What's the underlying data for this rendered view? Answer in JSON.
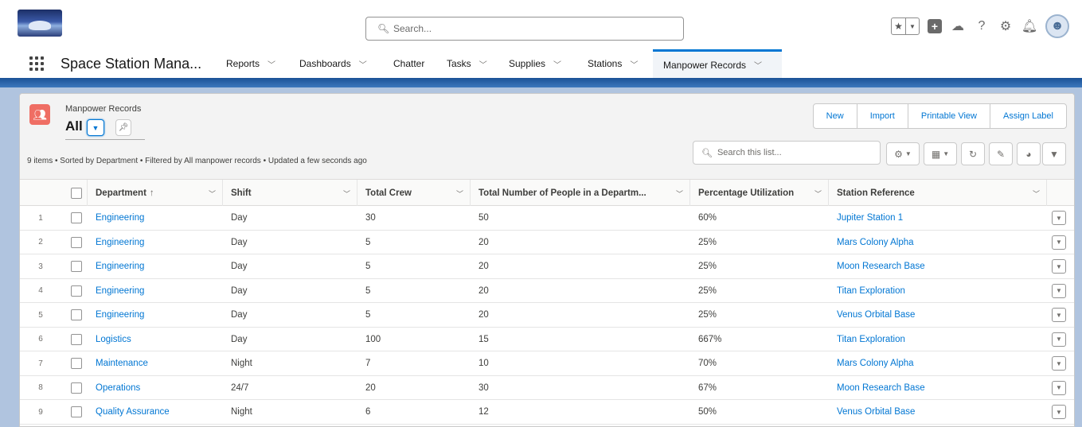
{
  "global_header": {
    "search_placeholder": "Search...",
    "icons": [
      "star-icon",
      "chevron-down-icon",
      "add-icon",
      "cloud-icon",
      "help-icon",
      "gear-icon",
      "bell-icon",
      "avatar"
    ]
  },
  "nav": {
    "app_name": "Space Station Mana...",
    "items": [
      {
        "label": "Reports",
        "has_menu": true
      },
      {
        "label": "Dashboards",
        "has_menu": true
      },
      {
        "label": "Chatter",
        "has_menu": false
      },
      {
        "label": "Tasks",
        "has_menu": true
      },
      {
        "label": "Supplies",
        "has_menu": true
      },
      {
        "label": "Stations",
        "has_menu": true
      },
      {
        "label": "Manpower Records",
        "has_menu": true,
        "active": true
      }
    ]
  },
  "list_view": {
    "object_label": "Manpower Records",
    "view_name": "All",
    "actions": [
      "New",
      "Import",
      "Printable View",
      "Assign Label"
    ],
    "meta": "9 items • Sorted by Department • Filtered by All manpower records • Updated a few seconds ago",
    "search_placeholder": "Search this list...",
    "columns": [
      "Department",
      "Shift",
      "Total Crew",
      "Total Number of People in a Departm...",
      "Percentage Utilization",
      "Station Reference"
    ],
    "sort_indicator": "↑",
    "rows": [
      {
        "num": "1",
        "department": "Engineering",
        "shift": "Day",
        "total_crew": "30",
        "total_people": "50",
        "utilization": "60%",
        "station": "Jupiter Station 1"
      },
      {
        "num": "2",
        "department": "Engineering",
        "shift": "Day",
        "total_crew": "5",
        "total_people": "20",
        "utilization": "25%",
        "station": "Mars Colony Alpha"
      },
      {
        "num": "3",
        "department": "Engineering",
        "shift": "Day",
        "total_crew": "5",
        "total_people": "20",
        "utilization": "25%",
        "station": "Moon Research Base"
      },
      {
        "num": "4",
        "department": "Engineering",
        "shift": "Day",
        "total_crew": "5",
        "total_people": "20",
        "utilization": "25%",
        "station": "Titan Exploration"
      },
      {
        "num": "5",
        "department": "Engineering",
        "shift": "Day",
        "total_crew": "5",
        "total_people": "20",
        "utilization": "25%",
        "station": "Venus Orbital Base"
      },
      {
        "num": "6",
        "department": "Logistics",
        "shift": "Day",
        "total_crew": "100",
        "total_people": "15",
        "utilization": "667%",
        "station": "Titan Exploration"
      },
      {
        "num": "7",
        "department": "Maintenance",
        "shift": "Night",
        "total_crew": "7",
        "total_people": "10",
        "utilization": "70%",
        "station": "Mars Colony Alpha"
      },
      {
        "num": "8",
        "department": "Operations",
        "shift": "24/7",
        "total_crew": "20",
        "total_people": "30",
        "utilization": "67%",
        "station": "Moon Research Base"
      },
      {
        "num": "9",
        "department": "Quality Assurance",
        "shift": "Night",
        "total_crew": "6",
        "total_people": "12",
        "utilization": "50%",
        "station": "Venus Orbital Base"
      }
    ]
  },
  "colors": {
    "brand_blue": "#0176d3",
    "object_icon": "#ef6e64",
    "band": "#1b5297"
  }
}
